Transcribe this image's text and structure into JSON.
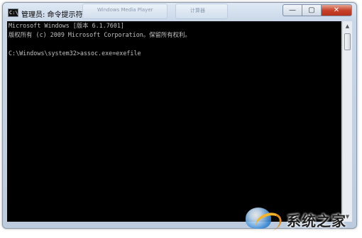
{
  "window": {
    "title": "管理员: 命令提示符",
    "icon_label": "C:\\",
    "caption_buttons": {
      "minimize": "—",
      "maximize": "▢",
      "close": "✕"
    }
  },
  "background_tabs": [
    "Windows Media Player",
    "计算器"
  ],
  "console": {
    "lines": [
      "Microsoft Windows [版本 6.1.7601]",
      "版权所有 (c) 2009 Microsoft Corporation。保留所有权利。",
      "",
      "C:\\Windows\\system32>assoc.exe=exefile"
    ]
  },
  "scrollbar": {
    "up": "▲",
    "down": "▼"
  },
  "watermark": {
    "text": "系统之家"
  },
  "colors": {
    "console_bg": "#000000",
    "console_text": "#c0c0c0",
    "close_red": "#c7432b"
  }
}
